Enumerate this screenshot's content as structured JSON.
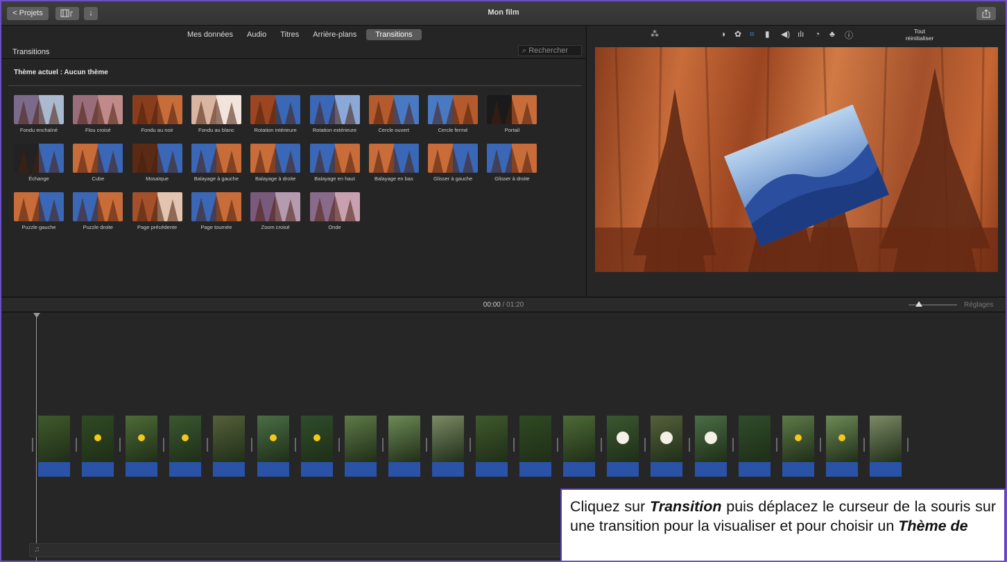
{
  "topbar": {
    "projects_label": "< Projets",
    "media_icon": "film-music-icon",
    "import_icon": "download-arrow-icon",
    "title": "Mon film",
    "share_icon": "share-icon"
  },
  "browser": {
    "tabs": [
      {
        "label": "Mes données",
        "active": false
      },
      {
        "label": "Audio",
        "active": false
      },
      {
        "label": "Titres",
        "active": false
      },
      {
        "label": "Arrière-plans",
        "active": false
      },
      {
        "label": "Transitions",
        "active": true
      }
    ],
    "panel_title": "Transitions",
    "search_placeholder": "Rechercher",
    "theme_label": "Thème actuel : Aucun thème",
    "transitions": [
      "Fondu enchaîné",
      "Flou croisé",
      "Fondu au noir",
      "Fondu au blanc",
      "Rotation intérieure",
      "Rotation extérieure",
      "Cercle ouvert",
      "Cercle fermé",
      "Portail",
      "Échange",
      "Cube",
      "Mosaïque",
      "Balayage à gauche",
      "Balayage à droite",
      "Balayage en haut",
      "Balayage en bas",
      "Glisser à gauche",
      "Glisser à droite",
      "Puzzle gauche",
      "Puzzle droite",
      "Page précédente",
      "Page tournée",
      "Zoom croisé",
      "Onde"
    ]
  },
  "viewer": {
    "tools": [
      "magic-wand-icon",
      "color-balance-icon",
      "palette-icon",
      "crop-icon",
      "stabilization-icon",
      "volume-icon",
      "equalizer-icon",
      "speed-icon",
      "filter-icon",
      "info-icon"
    ],
    "reset_line1": "Tout",
    "reset_line2": "réinitialiser"
  },
  "timeline": {
    "current": "00:00",
    "separator": " / ",
    "total": "01:20",
    "settings_label": "Réglages",
    "clip_count": 20
  },
  "callout": {
    "t1": "Cliquez sur ",
    "b1": "Transition",
    "t2": " puis déplacez le curseur de la souris sur une transition pour la visualiser et pour choisir un ",
    "b2": "Thème de"
  }
}
